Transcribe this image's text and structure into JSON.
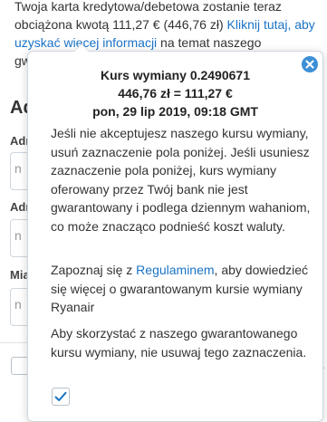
{
  "background": {
    "notice_lines": [
      "Twoja karta kredytowa/debetowa zostanie teraz",
      "obciążona kwotą 111,27 € (446,76 zł) "
    ],
    "notice_link": "Kliknij tutaj, aby uzyskać więcej informacji",
    "notice_tail": " na temat naszego",
    "notice_line3_start": "gw",
    "heading_fragment": "Ad",
    "labels": [
      "Adr",
      "Adr",
      "Mia"
    ],
    "placeholders": [
      "n",
      "n",
      "n"
    ]
  },
  "popover": {
    "rate_line": "Kurs wymiany 0.2490671",
    "conversion_line": "446,76 zł = 111,27 €",
    "date_line": "pon, 29 lip 2019, 09:18 GMT",
    "paragraph1": "Jeśli nie akceptujesz naszego kursu wymiany, usuń zaznaczenie pola poniżej. Jeśli usuniesz zaznaczenie pola poniżej, kurs wymiany oferowany przez Twój bank nie jest gwarantowany i podlega dziennym wahaniom, co może znacząco podnieść koszt waluty.",
    "p2_before": "Zapoznaj się z ",
    "p2_link": "Regulaminem",
    "p2_after": ", aby dowiedzieć się więcej o gwarantowanym kursie wymiany Ryanair",
    "paragraph3": "Aby skorzystać z naszego gwarantowanego kursu wymiany, nie usuwaj tego zaznaczenia.",
    "checkbox_checked": true,
    "close_icon": "close-icon",
    "check_icon": "checkmark-icon"
  },
  "colors": {
    "link": "#1a73c7",
    "close_button": "#3d8fd6",
    "checkmark": "#1a73c7"
  }
}
